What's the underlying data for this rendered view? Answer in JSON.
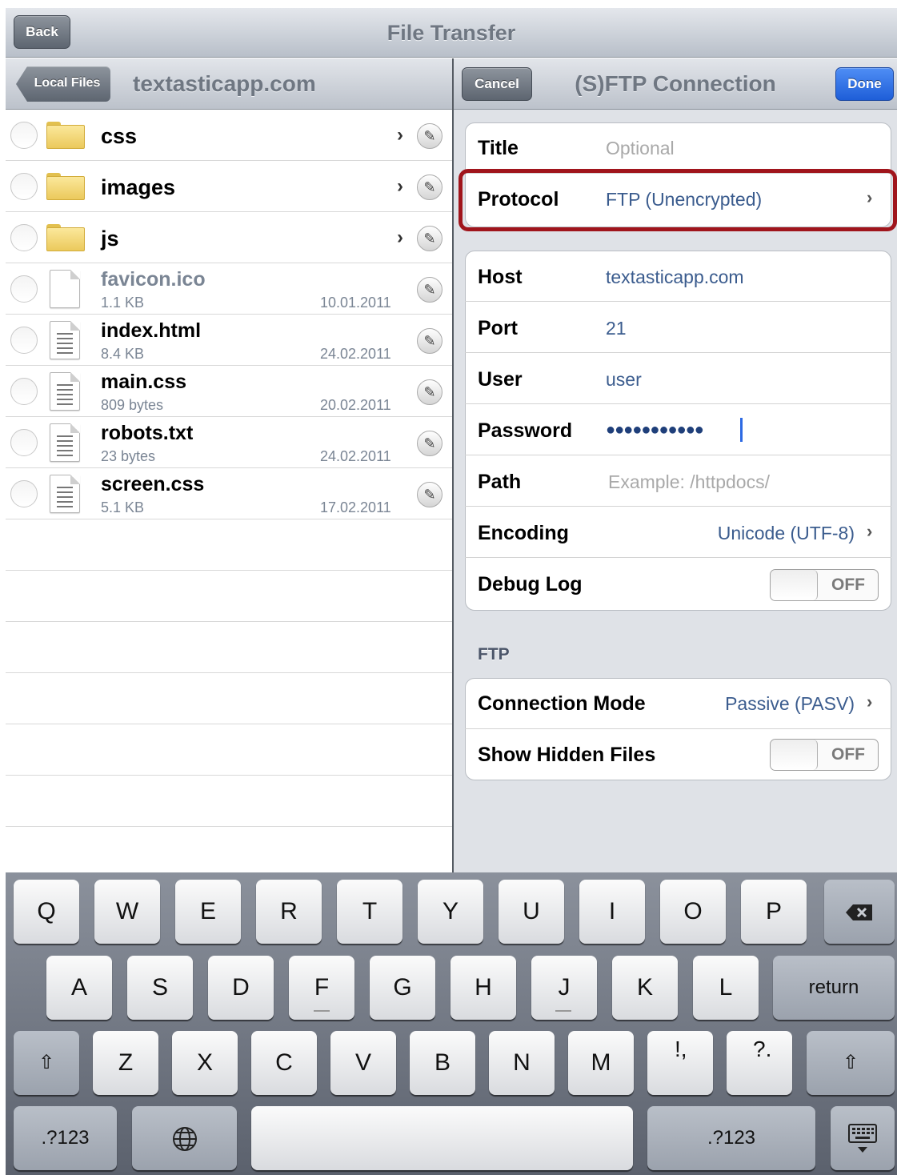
{
  "app": {
    "title": "File Transfer",
    "back_label": "Back"
  },
  "left": {
    "back_label": "Local Files",
    "title": "textasticapp.com",
    "folders": [
      {
        "name": "css"
      },
      {
        "name": "images"
      },
      {
        "name": "js"
      }
    ],
    "files": [
      {
        "name": "favicon.ico",
        "size": "1.1 KB",
        "date": "10.01.2011"
      },
      {
        "name": "index.html",
        "size": "8.4 KB",
        "date": "24.02.2011"
      },
      {
        "name": "main.css",
        "size": "809 bytes",
        "date": "20.02.2011"
      },
      {
        "name": "robots.txt",
        "size": "23 bytes",
        "date": "24.02.2011"
      },
      {
        "name": "screen.css",
        "size": "5.1 KB",
        "date": "17.02.2011"
      }
    ]
  },
  "right": {
    "cancel_label": "Cancel",
    "title": "(S)FTP Connection",
    "done_label": "Done",
    "fields": {
      "title_label": "Title",
      "title_placeholder": "Optional",
      "protocol_label": "Protocol",
      "protocol_value": "FTP (Unencrypted)",
      "host_label": "Host",
      "host_value": "textasticapp.com",
      "port_label": "Port",
      "port_value": "21",
      "user_label": "User",
      "user_value": "user",
      "password_label": "Password",
      "password_value": "●●●●●●●●●●●",
      "path_label": "Path",
      "path_placeholder": "Example: /httpdocs/",
      "encoding_label": "Encoding",
      "encoding_value": "Unicode (UTF-8)",
      "debug_label": "Debug Log",
      "debug_value": "OFF"
    },
    "ftp_section": {
      "header": "FTP",
      "mode_label": "Connection Mode",
      "mode_value": "Passive (PASV)",
      "hidden_label": "Show Hidden Files",
      "hidden_value": "OFF"
    }
  },
  "keyboard": {
    "row1": [
      "Q",
      "W",
      "E",
      "R",
      "T",
      "Y",
      "U",
      "I",
      "O",
      "P"
    ],
    "row2": [
      "A",
      "S",
      "D",
      "F",
      "G",
      "H",
      "J",
      "K",
      "L"
    ],
    "row3": [
      "Z",
      "X",
      "C",
      "V",
      "B",
      "N",
      "M"
    ],
    "return_label": "return",
    "numbers_label": ".?123",
    "punct1": "!,",
    "punct2": "?."
  },
  "colors": {
    "highlight": "#a0151c",
    "done_button": "#2766e0",
    "value_text": "#3b5c8e"
  }
}
